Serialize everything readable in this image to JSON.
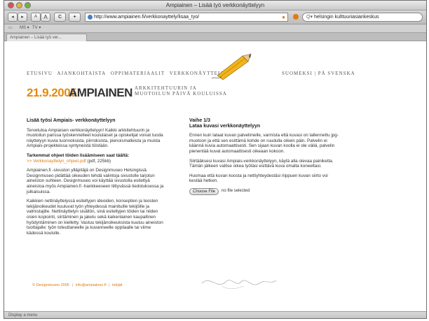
{
  "window": {
    "title": "Ampiainen – Lisää työ verkkonäyttelyyn"
  },
  "toolbar": {
    "back": "◂",
    "forward": "▸",
    "text_smaller": "A",
    "text_larger": "A",
    "reload": "C",
    "add_bookmark": "+",
    "url": "http://www.ampiainen.fi/verkkonayttely/lisaa_tyo/",
    "search_value": "helsingin kulttuuriasiankeskus"
  },
  "bookmarks": {
    "items": [
      "MS ▾",
      "TV ▾"
    ]
  },
  "tabs": [
    {
      "label": "Ampiainen – Lisää työ ver..."
    }
  ],
  "nav": {
    "items": [
      "ETUSIVU",
      "AJANKOHTAISTA",
      "OPPIMATERIAALIT",
      "VERKKONÄYTTELY"
    ],
    "lang_fi": "SUOMEKSI",
    "lang_sep": "|",
    "lang_sv": "PÅ SVENSKA"
  },
  "logo": {
    "date": "21.9.2005",
    "name": "AMPIAINEN",
    "subtitle_line1": "ARKKITEHTUURIN JA",
    "subtitle_line2": "MUOTOILUN PÄIVÄ KOULUISSA"
  },
  "left": {
    "heading": "Lisää työsi Ampiais- verkkonäyttelyyn",
    "intro": "Tervetuloa Ampiaisen verkkonäyttelyyn! Kaikki arkkitehtuurin ja muotoilun parissa työskennelleet koululaiset ja opiskelijat voivat tuoda näyttelyyn kuvia luonnoksista, piirroksista, pienoismalleista ja muista Ampiais-projekteissa syntyneistä töistään.",
    "instructions_heading": "Tarkemmat ohjeet töiden lisäämiseen saat täältä:",
    "instructions_link": ">> Verkkonayttelyn_ohjeet.pdf",
    "instructions_meta": "(pdf, 225kb)",
    "para2": "Ampiainen.fi -sivuston ylläpitäjä on Designmuseo Helsingissä. Designmuseo pidättää oikeuden tehdä valintoja sivustolle tarjotun aineiston suhteen. Designmuseo voi käyttää sivustolla esiteltyä aineistoa myös Ampiainen.fi -hankkeeseen liittyvässä tiedotuksessa ja julkaisuissa.",
    "para3": "Kaikkien nettinäyttelyssä esiteltyjen ideoiden, konseptien ja teosten tekijänoikeudet kuuluvat työn yhteydessä mainituille tekijöille ja valmistajille. Nettinäyttelyn sisällön, sinä esiteltyjen töiden tai niiden osien kopiointi, siirtäminen ja jakelu sekä kaikenlainen kaupallinen hyödyntäminen on kielletty. Vastuu tekijänoikeuksista kuuluu aineiston tuottajalle: työn toteuttaneelle ja kuvanneelle oppilaalle tai viime kädessä koululle."
  },
  "right": {
    "step": "Vaihe 1/3",
    "heading": "Lataa kuvasi verkkonäyttelyyn",
    "para1": "Ennen kuin lataat kuvan palvelimelle, varmista että kuvasi on tallennettu jpg-muotoon ja että sen esittämä kohde on ruudulla oikein päin. Palvelin ei käännä kuvia automaattisesti. Sen sijaan kuvan koolla ei ole väliä, palvelin pienentää kuvat automaattisesti oikeaan kokoon.",
    "para2": "Siirtääksesi kuvasi Ampiais-verkkonäyttelyyn, käytä alla olevaa painiketta. Tämän jälkeen valitse oikea työtäsi esittävä kuva omalta koneeltasi.",
    "para3": "Huomaa että kuvan koosta ja nettiyhteydestäsi riippuen kuvan siirto voi kestää hetken.",
    "choose_file": "Choose File",
    "no_file": "no file selected"
  },
  "footer": {
    "copyright": "© Designmuseo 2005",
    "email": "info@ampiainen.fi",
    "credits": "tekijät",
    "sep": "|"
  },
  "status": {
    "text": "Display a menu"
  },
  "colors": {
    "accent": "#e07a10",
    "text": "#333333"
  }
}
